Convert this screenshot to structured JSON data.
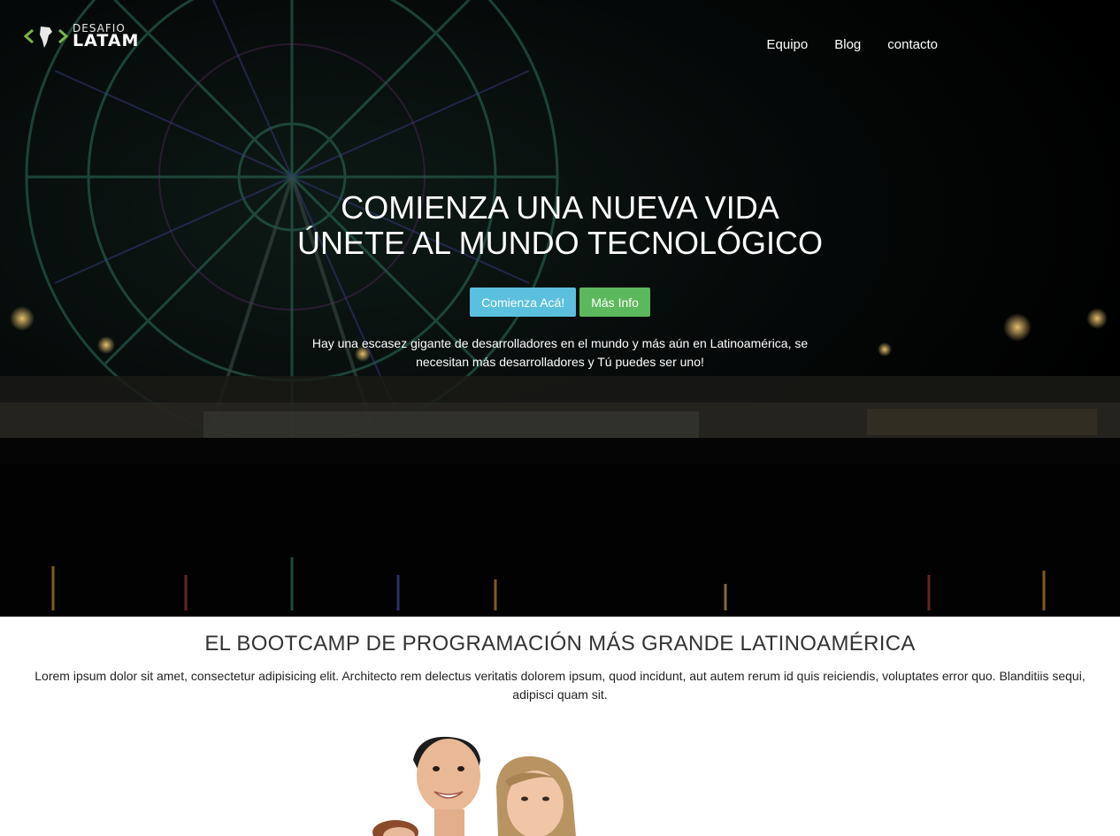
{
  "brand": {
    "logo_top": "DESAFIO",
    "logo_bottom": "LATAM"
  },
  "nav": {
    "items": [
      {
        "label": "Equipo"
      },
      {
        "label": "Blog"
      },
      {
        "label": "contacto"
      }
    ]
  },
  "hero": {
    "title_line1": "COMIENZA UNA NUEVA VIDA",
    "title_line2": "ÚNETE AL MUNDO TECNOLÓGICO",
    "primary_button": "Comienza Acá!",
    "secondary_button": "Más Info",
    "description": "Hay una escasez gigante de desarrolladores en el mundo y más aún en Latinoamérica, se necesitan más desarrolladores y Tú puedes ser uno!"
  },
  "section": {
    "title": "EL BOOTCAMP DE PROGRAMACIÓN MÁS GRANDE LATINOAMÉRICA",
    "text": "Lorem ipsum dolor sit amet, consectetur adipisicing elit. Architecto rem delectus veritatis dolorem ipsum, quod incidunt, aut autem rerum id quis reiciendis, voluptates error quo. Blanditiis sequi, adipisci quam sit."
  },
  "colors": {
    "info": "#5bc0de",
    "success": "#5cb85c",
    "brand_green": "#7ab648"
  }
}
